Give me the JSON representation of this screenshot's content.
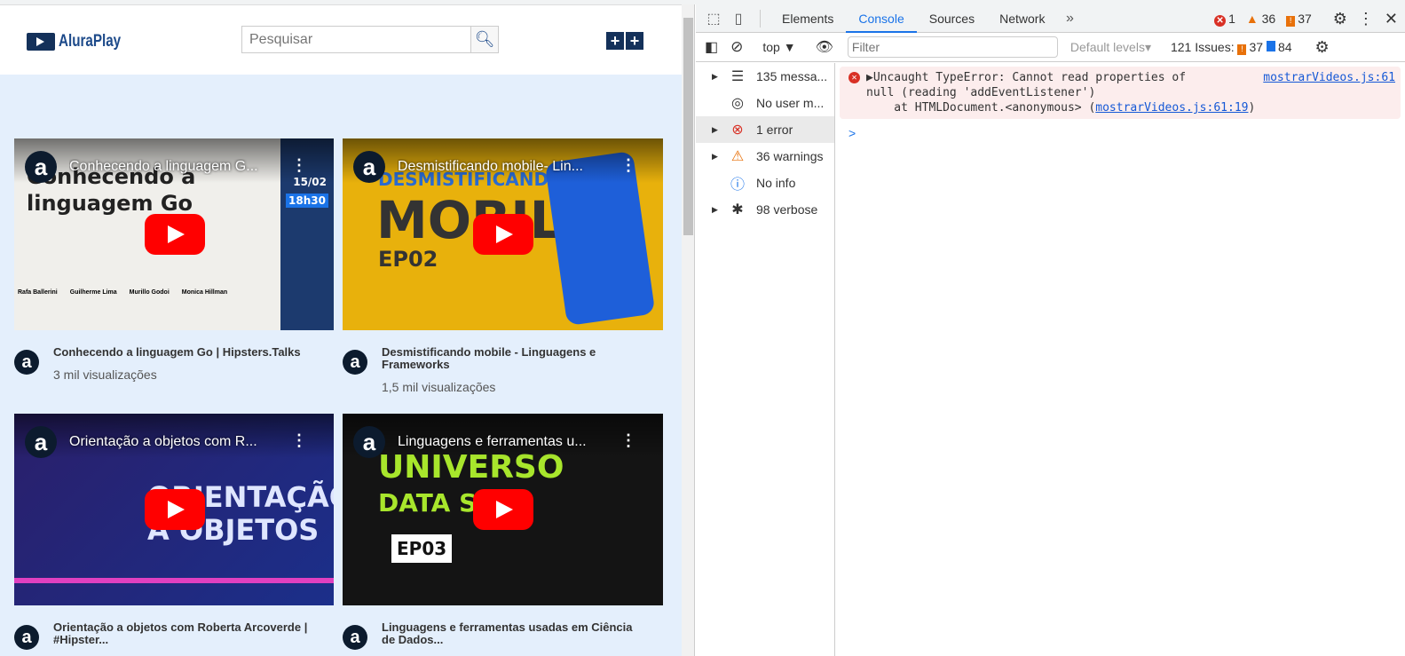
{
  "site": {
    "logo": "AluraPlay",
    "search_placeholder": "Pesquisar",
    "add_icon": "add-video-icon",
    "videos": [
      {
        "title": "Conhecendo a linguagem Go | Hipsters.Talks",
        "overlay": "Conhecendo a linguagem G...",
        "views": "3 mil visualizações",
        "thumb_text": "Conhecendo a linguagem Go",
        "date": "15/02",
        "time": "18h30",
        "people": [
          "Rafa Ballerini",
          "Guilherme Lima",
          "Murillo Godoi",
          "Monica Hillman"
        ],
        "bg": "#f0efeb"
      },
      {
        "title": "Desmistificando mobile - Linguagens e Frameworks",
        "overlay": "Desmistificando mobile- Lin...",
        "views": "1,5 mil visualizações",
        "thumb_text": "MOBILE",
        "thumb_sub": "EP02",
        "thumb_top": "DESMISTIFICANDO",
        "bg": "#e8b10c"
      },
      {
        "title": "Orientação a objetos com Roberta Arcoverde | #Hipster...",
        "overlay": "Orientação a objetos com R...",
        "views": "",
        "thumb_text": "ORIENTAÇÃO",
        "thumb_sub": "A OBJETOS",
        "bg": "#2a1f6b"
      },
      {
        "title": "Linguagens e ferramentas usadas em Ciência de Dados...",
        "overlay": "Linguagens e ferramentas u...",
        "views": "",
        "thumb_text": "UNIVERSO",
        "thumb_sub": "DATA SCI",
        "thumb_ep": "EP03",
        "bg": "#141414"
      }
    ]
  },
  "devtools": {
    "tabs": [
      "Elements",
      "Console",
      "Sources",
      "Network"
    ],
    "active_tab": "Console",
    "errors": "1",
    "warnings": "36",
    "issues": "37",
    "context": "top",
    "filter_placeholder": "Filter",
    "levels": "Default levels",
    "issues_label": "121 Issues:",
    "issues_warn": "37",
    "issues_info": "84",
    "sidebar": [
      {
        "label": "135 messa...",
        "icon": "list-icon",
        "expandable": true
      },
      {
        "label": "No user m...",
        "icon": "user-icon",
        "expandable": false
      },
      {
        "label": "1 error",
        "icon": "error-icon",
        "expandable": true,
        "selected": true
      },
      {
        "label": "36 warnings",
        "icon": "warning-icon",
        "expandable": true
      },
      {
        "label": "No info",
        "icon": "info-icon",
        "expandable": false
      },
      {
        "label": "98 verbose",
        "icon": "bug-icon",
        "expandable": true
      }
    ],
    "message": {
      "line1": "Uncaught TypeError: Cannot read properties of",
      "line2": "null (reading 'addEventListener')",
      "line3": "    at HTMLDocument.<anonymous> (",
      "link2": "mostrarVideos.js:61:19",
      "close_paren": ")",
      "source": "mostrarVideos.js:61"
    },
    "prompt": ">"
  }
}
